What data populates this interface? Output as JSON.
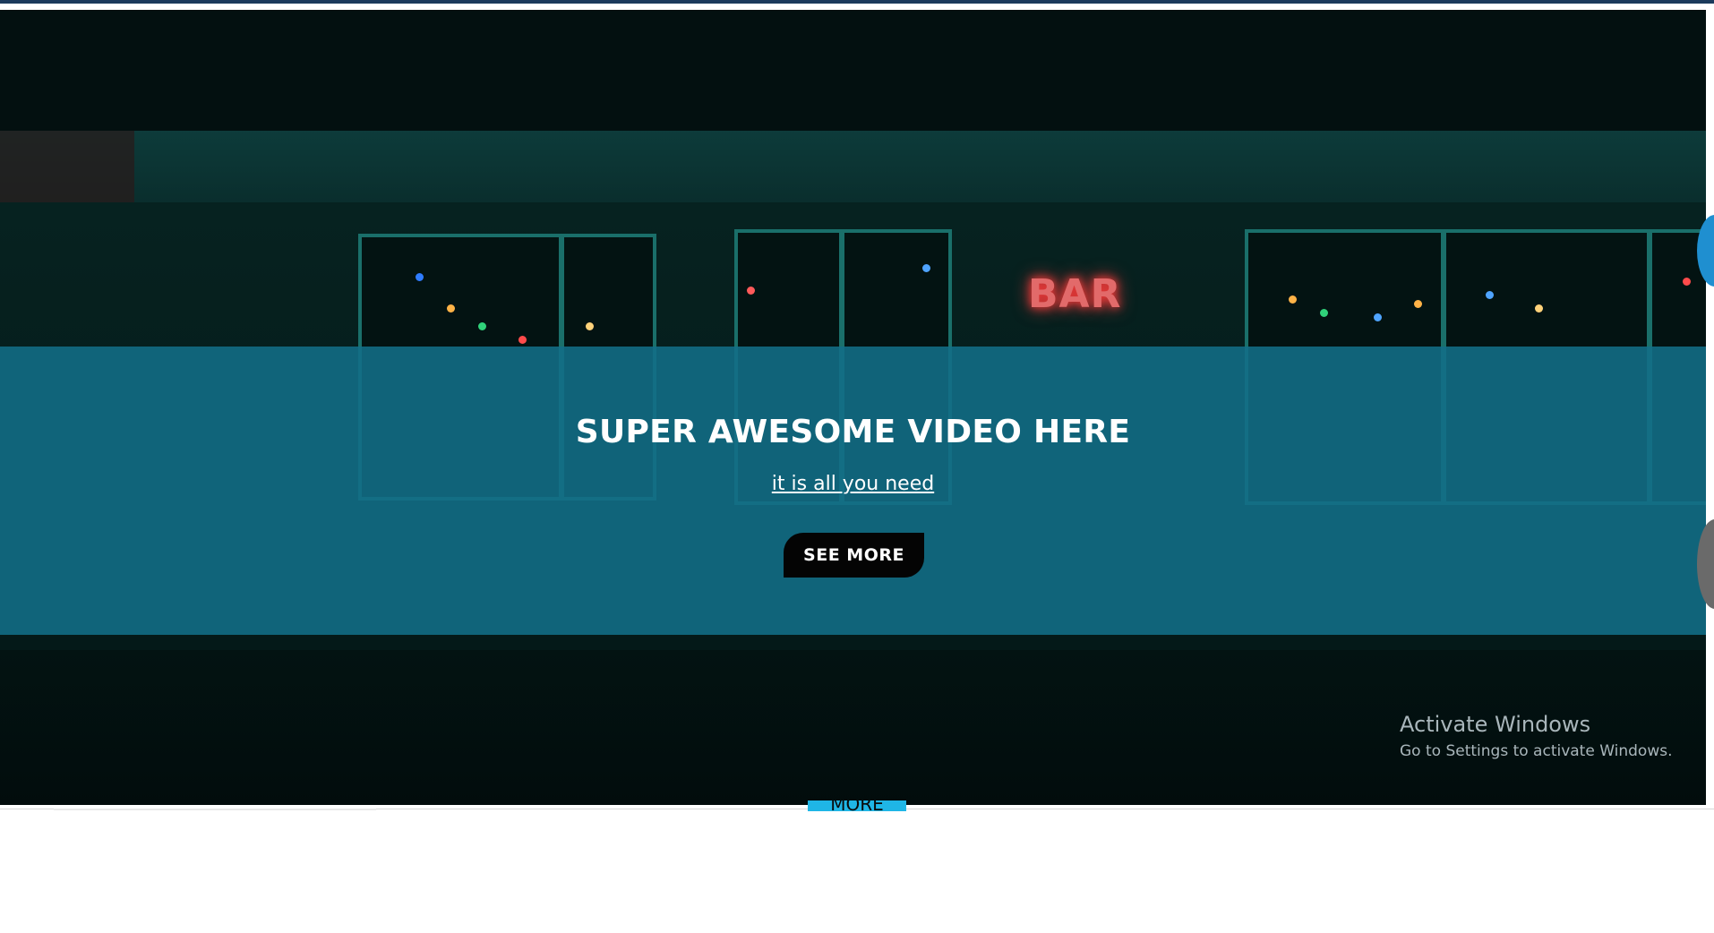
{
  "hero": {
    "sign_text": "BAR",
    "title": "SUPER AWESOME VIDEO HERE",
    "subtitle": "it is all you need",
    "cta_label": "SEE MORE"
  },
  "below": {
    "tab_label": "MORE"
  },
  "windows_watermark": {
    "title": "Activate Windows",
    "subtitle": "Go to Settings to activate Windows."
  },
  "colors": {
    "band": "#126e87",
    "cta_bg": "#040404",
    "accent_tab": "#1fb6e6",
    "top_bar": "#1b3a5c"
  }
}
